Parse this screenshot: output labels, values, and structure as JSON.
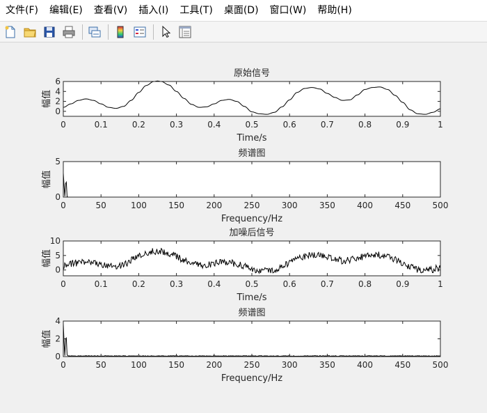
{
  "menu": {
    "items": [
      {
        "id": "file",
        "label": "文件(F)"
      },
      {
        "id": "edit",
        "label": "编辑(E)"
      },
      {
        "id": "view",
        "label": "查看(V)"
      },
      {
        "id": "insert",
        "label": "插入(I)"
      },
      {
        "id": "tools",
        "label": "工具(T)"
      },
      {
        "id": "desktop",
        "label": "桌面(D)"
      },
      {
        "id": "window",
        "label": "窗口(W)"
      },
      {
        "id": "help",
        "label": "帮助(H)"
      }
    ]
  },
  "toolbar": {
    "icons": [
      "new-figure-icon",
      "open-file-icon",
      "save-icon",
      "print-icon",
      "link-icon",
      "colorbar-icon",
      "legend-icon",
      "pointer-icon",
      "property-inspector-icon"
    ]
  },
  "colors": {
    "line": "#000000",
    "axes_bg": "#ffffff",
    "figure_bg": "#f0f0f0"
  },
  "chart_data": [
    {
      "type": "line",
      "title": "原始信号",
      "xlabel": "Time/s",
      "ylabel": "幅值",
      "xlim": [
        0,
        1
      ],
      "ylim": [
        -1,
        6
      ],
      "xticks": [
        "0",
        "0.1",
        "0.2",
        "0.3",
        "0.4",
        "0.5",
        "0.6",
        "0.7",
        "0.8",
        "0.9",
        "1"
      ],
      "yticks": [
        "0",
        "2",
        "4",
        "6"
      ],
      "series": [
        {
          "x": [
            0,
            0.02,
            0.04,
            0.06,
            0.08,
            0.1,
            0.12,
            0.14,
            0.16,
            0.18,
            0.2,
            0.22,
            0.24,
            0.25,
            0.26,
            0.28,
            0.3,
            0.32,
            0.34,
            0.36,
            0.38,
            0.4,
            0.42,
            0.44,
            0.46,
            0.48,
            0.5,
            0.52,
            0.54,
            0.56,
            0.58,
            0.6,
            0.62,
            0.64,
            0.66,
            0.68,
            0.7,
            0.72,
            0.74,
            0.76,
            0.78,
            0.8,
            0.82,
            0.84,
            0.86,
            0.88,
            0.9,
            0.92,
            0.94,
            0.96,
            0.98,
            1
          ],
          "y": [
            0.8,
            1.5,
            2.2,
            2.5,
            2.2,
            1.5,
            0.8,
            0.6,
            1.0,
            2.2,
            3.8,
            5.2,
            6.0,
            6.1,
            6.0,
            5.3,
            4.0,
            2.6,
            1.4,
            0.8,
            0.9,
            1.5,
            2.2,
            2.4,
            2.0,
            1.0,
            -0.1,
            -0.5,
            -0.6,
            -0.2,
            0.9,
            2.3,
            3.8,
            4.6,
            4.8,
            4.5,
            3.6,
            2.8,
            2.2,
            2.3,
            3.3,
            4.4,
            4.8,
            4.9,
            4.4,
            3.2,
            1.8,
            0.3,
            -0.5,
            -0.6,
            -0.2,
            0.5
          ]
        }
      ]
    },
    {
      "type": "line",
      "title": "频谱图",
      "xlabel": "Frequency/Hz",
      "ylabel": "幅值",
      "xlim": [
        0,
        500
      ],
      "ylim": [
        0,
        5
      ],
      "xticks": [
        "0",
        "50",
        "100",
        "150",
        "200",
        "250",
        "300",
        "350",
        "400",
        "450",
        "500"
      ],
      "yticks": [
        "0",
        "5"
      ],
      "series": [
        {
          "x": [
            0,
            1,
            2,
            3,
            4,
            5,
            6,
            7,
            8,
            500
          ],
          "y": [
            3.4,
            1.6,
            0.1,
            1.9,
            2.1,
            0.1,
            0.0,
            0.0,
            0.0,
            0.0
          ]
        }
      ]
    },
    {
      "type": "line",
      "title": "加噪后信号",
      "xlabel": "Time/s",
      "ylabel": "幅值",
      "xlim": [
        0,
        1
      ],
      "ylim": [
        -2,
        10
      ],
      "xticks": [
        "0",
        "0.1",
        "0.2",
        "0.3",
        "0.4",
        "0.5",
        "0.6",
        "0.7",
        "0.8",
        "0.9",
        "1"
      ],
      "yticks": [
        "0",
        "5",
        "10"
      ],
      "noise_amplitude": 1.2,
      "series": [
        {
          "x": [
            0,
            0.02,
            0.04,
            0.06,
            0.08,
            0.1,
            0.12,
            0.14,
            0.16,
            0.18,
            0.2,
            0.22,
            0.24,
            0.25,
            0.26,
            0.28,
            0.3,
            0.32,
            0.34,
            0.36,
            0.38,
            0.4,
            0.42,
            0.44,
            0.46,
            0.48,
            0.5,
            0.52,
            0.54,
            0.56,
            0.58,
            0.6,
            0.62,
            0.64,
            0.66,
            0.68,
            0.7,
            0.72,
            0.74,
            0.76,
            0.78,
            0.8,
            0.82,
            0.84,
            0.86,
            0.88,
            0.9,
            0.92,
            0.94,
            0.96,
            0.98,
            1
          ],
          "y": [
            1.3,
            2.0,
            2.6,
            2.9,
            2.6,
            2.1,
            1.6,
            1.4,
            1.8,
            3.2,
            4.6,
            5.8,
            6.5,
            6.6,
            6.4,
            5.8,
            4.6,
            3.4,
            2.3,
            1.8,
            1.8,
            2.2,
            2.7,
            2.6,
            2.2,
            1.2,
            0.2,
            -0.2,
            -0.3,
            0.2,
            1.3,
            2.6,
            3.9,
            4.8,
            5.2,
            5.0,
            4.3,
            3.6,
            3.2,
            3.3,
            4.0,
            4.8,
            5.1,
            5.2,
            4.6,
            3.5,
            2.2,
            0.9,
            0.2,
            -0.1,
            0.2,
            0.8
          ]
        }
      ]
    },
    {
      "type": "line",
      "title": "频谱图",
      "xlabel": "Frequency/Hz",
      "ylabel": "幅值",
      "xlim": [
        0,
        500
      ],
      "ylim": [
        0,
        4
      ],
      "xticks": [
        "0",
        "50",
        "100",
        "150",
        "200",
        "250",
        "300",
        "350",
        "400",
        "450",
        "500"
      ],
      "yticks": [
        "0",
        "2",
        "4"
      ],
      "noise_floor": 0.08,
      "series": [
        {
          "x": [
            0,
            1,
            2,
            3,
            4,
            5,
            6,
            7,
            8,
            500
          ],
          "y": [
            3.7,
            1.6,
            0.1,
            2.0,
            2.1,
            0.2,
            0.1,
            0.08,
            0.08,
            0.08
          ]
        }
      ]
    }
  ]
}
